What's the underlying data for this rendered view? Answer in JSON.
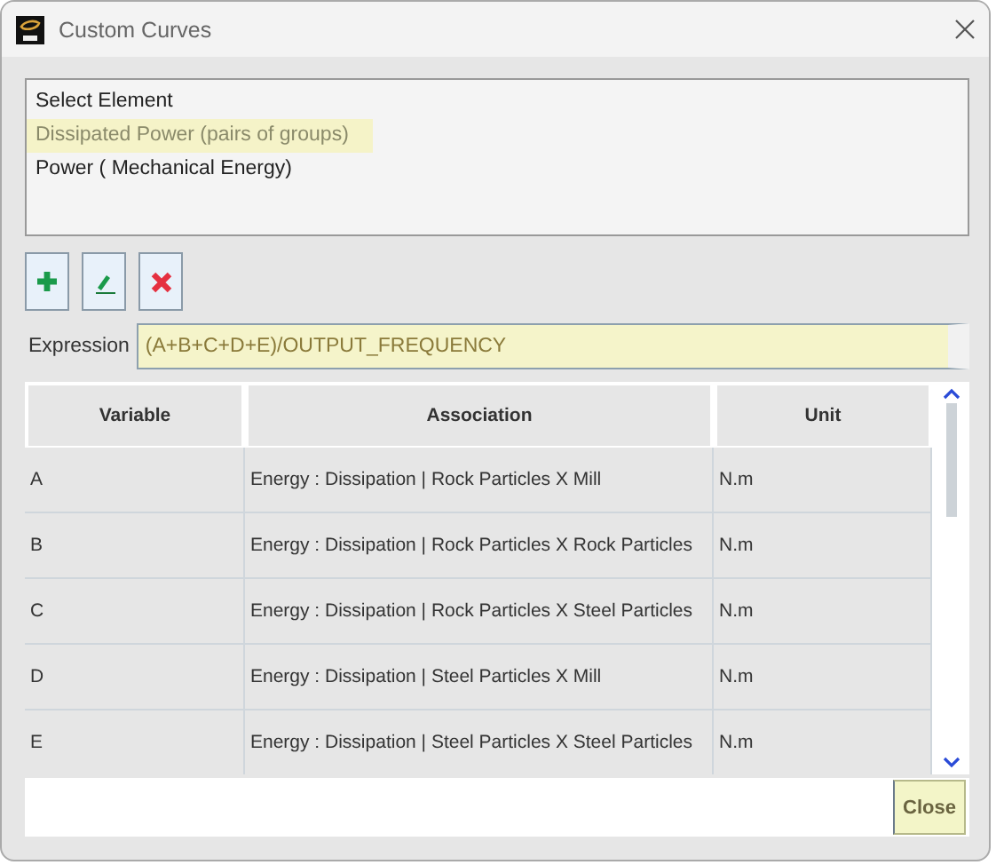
{
  "window": {
    "title": "Custom Curves"
  },
  "elements": [
    {
      "label": "Select Element",
      "selected": false
    },
    {
      "label": "Dissipated Power (pairs of groups)",
      "selected": true
    },
    {
      "label": "Power ( Mechanical Energy)",
      "selected": false
    }
  ],
  "expression": {
    "label": "Expression",
    "value": "(A+B+C+D+E)/OUTPUT_FREQUENCY"
  },
  "table": {
    "columns": [
      "Variable",
      "Association",
      "Unit"
    ],
    "rows": [
      [
        "A",
        "Energy : Dissipation | Rock Particles X Mill",
        "N.m"
      ],
      [
        "B",
        "Energy : Dissipation | Rock Particles X Rock Particles",
        "N.m"
      ],
      [
        "C",
        "Energy : Dissipation | Rock Particles X Steel Particles",
        "N.m"
      ],
      [
        "D",
        "Energy : Dissipation | Steel Particles X Mill",
        "N.m"
      ],
      [
        "E",
        "Energy : Dissipation | Steel Particles X Steel Particles",
        "N.m"
      ]
    ]
  },
  "buttons": [
    "Close"
  ]
}
